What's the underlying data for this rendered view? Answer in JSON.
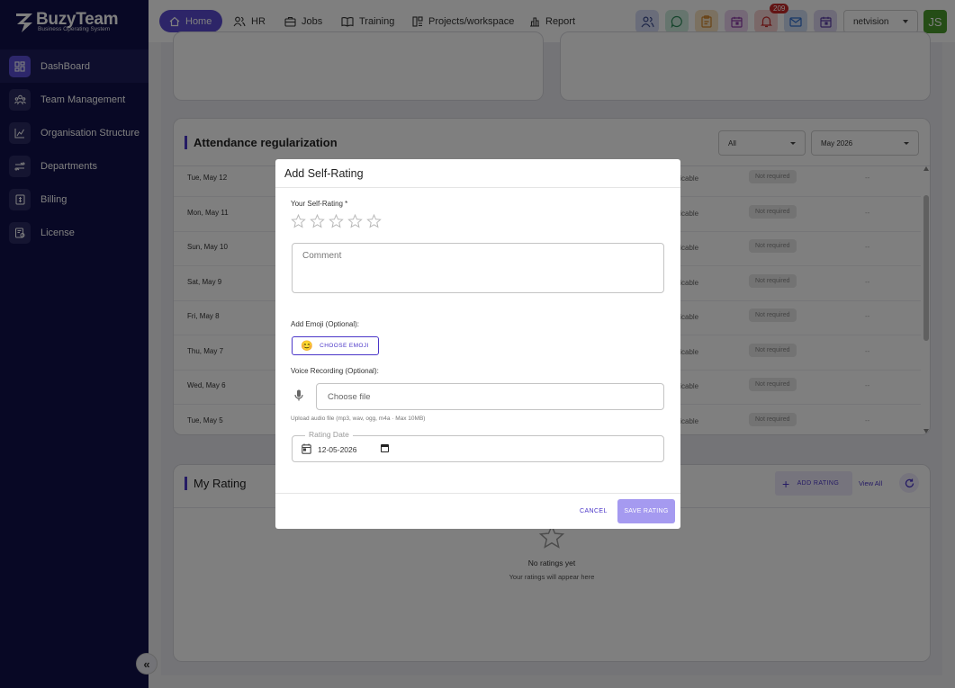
{
  "brand": {
    "title": "BuzyTeam",
    "subtitle": "Business Operating System"
  },
  "sidebar": {
    "items": [
      {
        "label": "DashBoard",
        "icon": "dashboard-icon",
        "active": true
      },
      {
        "label": "Team Management",
        "icon": "team-icon"
      },
      {
        "label": "Organisation Structure",
        "icon": "org-chart-icon"
      },
      {
        "label": "Departments",
        "icon": "departments-icon"
      },
      {
        "label": "Billing",
        "icon": "billing-icon"
      },
      {
        "label": "License",
        "icon": "license-icon"
      }
    ],
    "collapse_glyph": "«"
  },
  "topbar": {
    "nav": [
      {
        "label": "Home",
        "icon": "home-icon"
      },
      {
        "label": "HR",
        "icon": "people-icon"
      },
      {
        "label": "Jobs",
        "icon": "briefcase-icon"
      },
      {
        "label": "Training",
        "icon": "book-icon"
      },
      {
        "label": "Projects/workspace",
        "icon": "workspace-icon"
      },
      {
        "label": "Report",
        "icon": "report-icon"
      }
    ],
    "notification_count": "209",
    "org_name": "netvision",
    "avatar_initials": "JS"
  },
  "attendance": {
    "title": "Attendance regularization",
    "filter_value": "All",
    "month_value": "May 2026",
    "rows": [
      {
        "date": "Tue, May 12",
        "status": "plicable",
        "requirement": "Not required",
        "extra": "--"
      },
      {
        "date": "Mon, May 11",
        "status": "plicable",
        "requirement": "Not required",
        "extra": "--"
      },
      {
        "date": "Sun, May 10",
        "status": "plicable",
        "requirement": "Not required",
        "extra": "--"
      },
      {
        "date": "Sat, May 9",
        "status": "plicable",
        "requirement": "Not required",
        "extra": "--"
      },
      {
        "date": "Fri, May 8",
        "status": "plicable",
        "requirement": "Not required",
        "extra": "--"
      },
      {
        "date": "Thu, May 7",
        "status": "plicable",
        "requirement": "Not required",
        "extra": "--"
      },
      {
        "date": "Wed, May 6",
        "status": "plicable",
        "requirement": "Not required",
        "extra": "--"
      },
      {
        "date": "Tue, May 5",
        "status": "plicable",
        "requirement": "Not required",
        "extra": "--"
      }
    ]
  },
  "my_rating": {
    "title": "My Rating",
    "add_label": "ADD RATING",
    "view_all_label": "View All",
    "empty_title": "No ratings yet",
    "empty_subtitle": "Your ratings will appear here"
  },
  "modal": {
    "title": "Add Self-Rating",
    "rating_label": "Your Self-Rating *",
    "rating_value": 0,
    "rating_max": 5,
    "comment_placeholder": "Comment",
    "emoji_label": "Add Emoji (Optional):",
    "emoji_glyph": "😊",
    "emoji_button": "CHOOSE EMOJI",
    "voice_label": "Voice Recording (Optional):",
    "file_placeholder": "Choose file",
    "upload_hint": "Upload audio file (mp3, wav, ogg, m4a · Max 10MB)",
    "date_label": "Rating Date",
    "date_value": "12-05-2026",
    "cancel_label": "CANCEL",
    "save_label": "SAVE RATING"
  },
  "colors": {
    "sidebar": "#11114a",
    "accent": "#5b4bd1",
    "save_disabled": "#a59af0"
  }
}
